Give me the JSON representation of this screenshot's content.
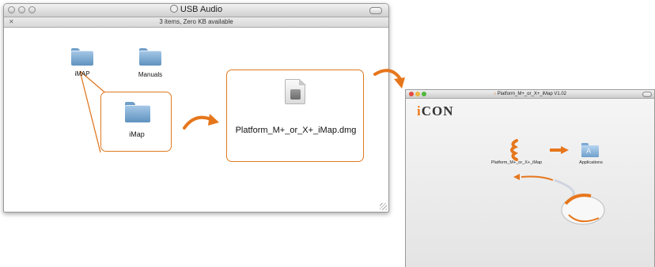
{
  "window1": {
    "title": "USB Audio",
    "status": "3 items, Zero KB available",
    "items": [
      {
        "label": "iMAP"
      },
      {
        "label": "Manuals"
      }
    ],
    "selected_item": {
      "label": "iMap"
    },
    "dmg_file": {
      "label": "Platform_M+_or_X+_iMap.dmg"
    }
  },
  "window2": {
    "title": "Platform_M+_or_X+_iMap V1.02",
    "brand_i": "i",
    "brand_rest": "CON",
    "app_label": "Platform_M+_or_X+_iMap",
    "target_label": "Applications"
  },
  "colors": {
    "accent": "#e07a22",
    "folder": "#6f9fc9"
  }
}
